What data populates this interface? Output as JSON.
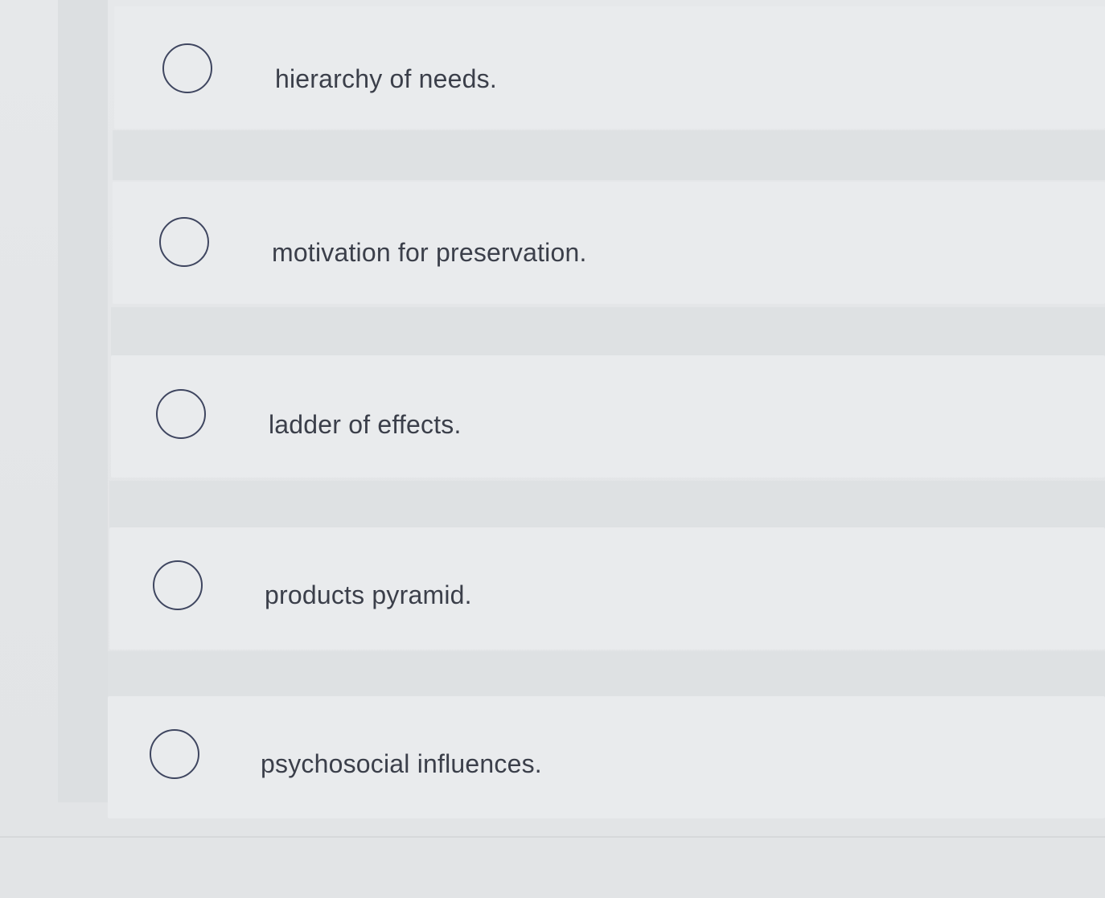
{
  "options": [
    {
      "label": "hierarchy of needs.",
      "selected": false
    },
    {
      "label": "motivation for preservation.",
      "selected": false
    },
    {
      "label": "ladder of effects.",
      "selected": false
    },
    {
      "label": "products pyramid.",
      "selected": false
    },
    {
      "label": "psychosocial influences.",
      "selected": false
    }
  ]
}
